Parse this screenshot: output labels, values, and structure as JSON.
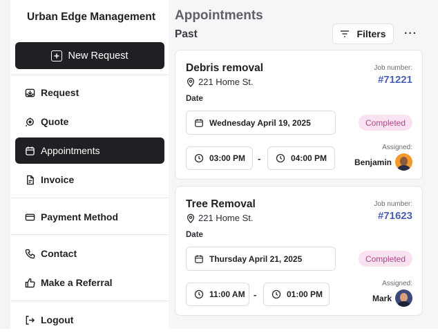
{
  "brand": "Urban Edge Management",
  "sidebar": {
    "new_request": "New Request",
    "items": [
      {
        "label": "Request"
      },
      {
        "label": "Quote"
      },
      {
        "label": "Appointments"
      },
      {
        "label": "Invoice"
      },
      {
        "label": "Payment Method"
      },
      {
        "label": "Contact"
      },
      {
        "label": "Make a Referral"
      },
      {
        "label": "Logout"
      }
    ],
    "active_item": "Appointments"
  },
  "main": {
    "title": "Appointments",
    "section": "Past",
    "filters_label": "Filters",
    "more_label": "···",
    "cards": [
      {
        "title": "Debris removal",
        "address": "221 Home St.",
        "date_label": "Date",
        "date": "Wednesday April 19, 2025",
        "job_label": "Job number:",
        "job_number": "#71221",
        "status": "Completed",
        "start_time": "03:00 PM",
        "end_time": "04:00 PM",
        "dash": "-",
        "assigned_label": "Assigned:",
        "assignee": "Benjamin"
      },
      {
        "title": "Tree Removal",
        "address": "221 Home St.",
        "date_label": "Date",
        "date": "Thursday April 21, 2025",
        "job_label": "Job number:",
        "job_number": "#71623",
        "status": "Completed",
        "start_time": "11:00 AM",
        "end_time": "01:00 PM",
        "dash": "-",
        "assigned_label": "Assigned:",
        "assignee": "Mark"
      }
    ]
  },
  "colors": {
    "dark": "#1f1f24",
    "job_number": "#4a5fb4",
    "status_bg": "#f9e3f0",
    "status_text": "#b0478a",
    "avatar_1": "#f29a2e",
    "avatar_2": "#3b4a7a"
  }
}
